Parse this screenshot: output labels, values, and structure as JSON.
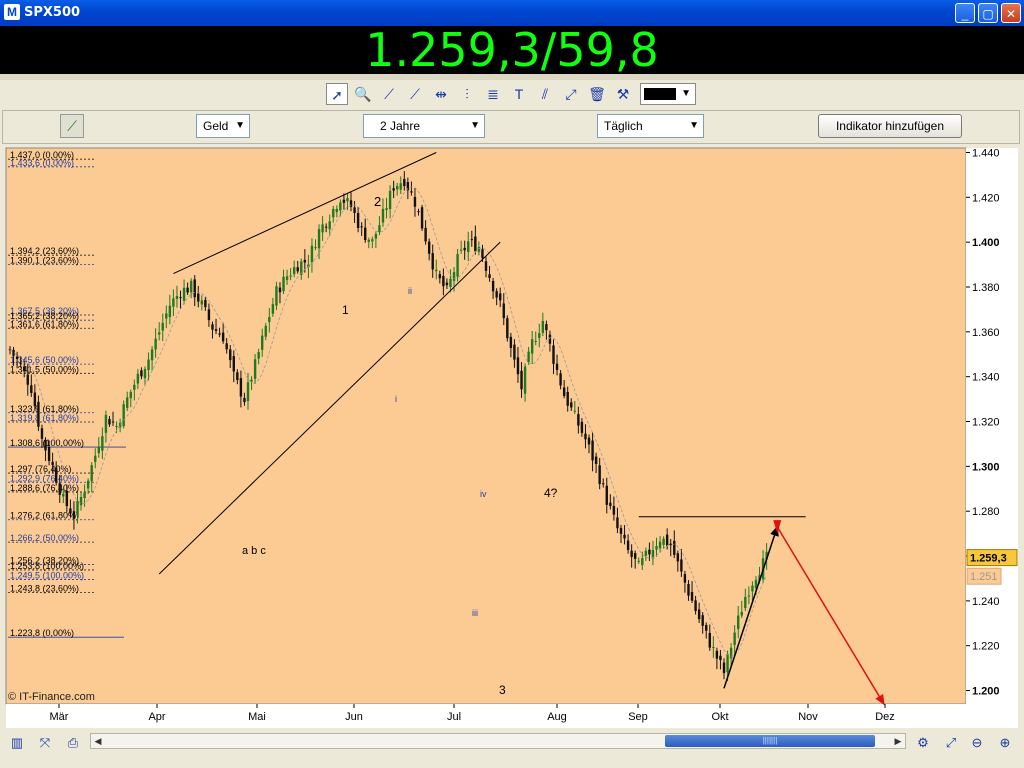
{
  "window": {
    "title": "SPX500",
    "min_label": "_",
    "max_label": "▢",
    "close_label": "✕"
  },
  "quote": {
    "value": "1.259,3/59,8"
  },
  "toolbar": {
    "tools": [
      "pointer-tool",
      "zoom-tool",
      "line-tool",
      "trendline-tool",
      "horizontal-line-tool",
      "vertical-line-tool",
      "fibonacci-tool",
      "text-tool",
      "channel-tool",
      "extend-tool",
      "delete-tool",
      "settings-tool"
    ]
  },
  "controls": {
    "price_type": "Geld",
    "period": "2 Jahre",
    "interval": "Täglich",
    "add_indicator": "Indikator hinzufügen"
  },
  "chart_data": {
    "type": "candlestick",
    "copyright": "© IT-Finance.com",
    "x_ticks": [
      "Mär",
      "Apr",
      "Mai",
      "Jun",
      "Jul",
      "Aug",
      "Sep",
      "Okt",
      "Nov",
      "Dez"
    ],
    "y_ticks": [
      "1.440",
      "1.420",
      "1.400",
      "1.380",
      "1.360",
      "1.340",
      "1.320",
      "1.300",
      "1.280",
      "1.260",
      "1.240",
      "1.220",
      "1.200"
    ],
    "y_tick_values": [
      1440,
      1420,
      1400,
      1380,
      1360,
      1340,
      1320,
      1300,
      1280,
      1260,
      1240,
      1220,
      1200
    ],
    "bold_y_ticks": [
      1400,
      1300,
      1200
    ],
    "ylim": [
      1194,
      1442
    ],
    "last_price_label": "1.259,3",
    "last_price_value": 1259.3,
    "secondary_price_label": "1.251",
    "secondary_price_value": 1251,
    "fib_labels": [
      {
        "text": "1.437,0 (0,00%)",
        "value": 1437.0
      },
      {
        "text": "1.433,6 (0,00%)",
        "value": 1433.6
      },
      {
        "text": "1.394,2 (23,60%)",
        "value": 1394.2
      },
      {
        "text": "1.390,1 (23,60%)",
        "value": 1390.1
      },
      {
        "text": "1.367,5 (38,20%)",
        "value": 1367.5
      },
      {
        "text": "1.365,2 (38,20%)",
        "value": 1365.2
      },
      {
        "text": "1.361,6 (61,80%)",
        "value": 1361.6
      },
      {
        "text": "1.345,6 (50,00%)",
        "value": 1345.6
      },
      {
        "text": "1.341,5 (50,00%)",
        "value": 1341.5
      },
      {
        "text": "1.323,9 (61,80%)",
        "value": 1323.9
      },
      {
        "text": "1.319,8 (61,80%)",
        "value": 1319.8
      },
      {
        "text": "1.308,6 (100,00%)",
        "value": 1308.6
      },
      {
        "text": "1.297 (76,40%)",
        "value": 1297.0
      },
      {
        "text": "1.292,9 (76,40%)",
        "value": 1292.9
      },
      {
        "text": "1.288,6 (76,40%)",
        "value": 1288.6
      },
      {
        "text": "1.276,2 (61,80%)",
        "value": 1276.2
      },
      {
        "text": "1.266,2 (50,00%)",
        "value": 1266.2
      },
      {
        "text": "1.256,2 (38,20%)",
        "value": 1256.2
      },
      {
        "text": "1.253,8 (100,00%)",
        "value": 1253.8
      },
      {
        "text": "1.249,5 (100,00%)",
        "value": 1249.5
      },
      {
        "text": "1.243,8 (23,60%)",
        "value": 1243.8
      },
      {
        "text": "1.223,8 (0,00%)",
        "value": 1223.8
      }
    ],
    "annotations": [
      {
        "text": "a b c",
        "x": "Mai",
        "y": 1258
      },
      {
        "text": "1",
        "x": "Mai-end",
        "y": 1364
      },
      {
        "text": "2",
        "x": "Mai-end",
        "y": 1410
      },
      {
        "text": "ii",
        "x": "Jun",
        "y": 1378
      },
      {
        "text": "i",
        "x": "Jun",
        "y": 1323
      },
      {
        "text": "iv",
        "x": "Jul",
        "y": 1282
      },
      {
        "text": "4?",
        "x": "Jul-end",
        "y": 1282
      },
      {
        "text": "iii",
        "x": "Jul",
        "y": 1228
      },
      {
        "text": "3",
        "x": "Jul",
        "y": 1196
      }
    ],
    "series": [
      {
        "type": "candlestick",
        "color": "#1e7a1e",
        "down_color": "#b01010"
      }
    ],
    "close_path": [
      [
        0,
        1352
      ],
      [
        3,
        1345
      ],
      [
        6,
        1335
      ],
      [
        9,
        1312
      ],
      [
        12,
        1300
      ],
      [
        15,
        1285
      ],
      [
        18,
        1278
      ],
      [
        21,
        1290
      ],
      [
        24,
        1305
      ],
      [
        27,
        1322
      ],
      [
        30,
        1318
      ],
      [
        33,
        1330
      ],
      [
        36,
        1340
      ],
      [
        39,
        1348
      ],
      [
        42,
        1360
      ],
      [
        45,
        1372
      ],
      [
        48,
        1378
      ],
      [
        51,
        1380
      ],
      [
        54,
        1372
      ],
      [
        57,
        1362
      ],
      [
        60,
        1358
      ],
      [
        63,
        1340
      ],
      [
        66,
        1330
      ],
      [
        69,
        1345
      ],
      [
        72,
        1362
      ],
      [
        75,
        1378
      ],
      [
        78,
        1385
      ],
      [
        81,
        1390
      ],
      [
        84,
        1392
      ],
      [
        87,
        1405
      ],
      [
        90,
        1412
      ],
      [
        93,
        1420
      ],
      [
        96,
        1416
      ],
      [
        99,
        1405
      ],
      [
        102,
        1400
      ],
      [
        105,
        1412
      ],
      [
        108,
        1425
      ],
      [
        111,
        1428
      ],
      [
        114,
        1418
      ],
      [
        117,
        1402
      ],
      [
        120,
        1385
      ],
      [
        123,
        1378
      ],
      [
        126,
        1392
      ],
      [
        129,
        1400
      ],
      [
        132,
        1398
      ],
      [
        135,
        1385
      ],
      [
        138,
        1372
      ],
      [
        141,
        1352
      ],
      [
        144,
        1335
      ],
      [
        147,
        1355
      ],
      [
        150,
        1365
      ],
      [
        153,
        1348
      ],
      [
        156,
        1332
      ],
      [
        159,
        1322
      ],
      [
        162,
        1312
      ],
      [
        165,
        1300
      ],
      [
        168,
        1285
      ],
      [
        171,
        1272
      ],
      [
        174,
        1262
      ],
      [
        177,
        1255
      ],
      [
        180,
        1262
      ],
      [
        183,
        1268
      ],
      [
        186,
        1265
      ],
      [
        189,
        1252
      ],
      [
        192,
        1240
      ],
      [
        195,
        1228
      ],
      [
        198,
        1218
      ],
      [
        201,
        1208
      ],
      [
        204,
        1226
      ],
      [
        207,
        1242
      ],
      [
        210,
        1252
      ],
      [
        213,
        1259
      ]
    ],
    "drawings": {
      "channel_upper": [
        [
          46,
          1386
        ],
        [
          120,
          1440
        ]
      ],
      "channel_lower": [
        [
          42,
          1252
        ],
        [
          138,
          1400
        ]
      ],
      "horizontal_4q": 1277.5,
      "black_arrow": [
        [
          201,
          1201
        ],
        [
          216,
          1273
        ]
      ],
      "red_arrow": [
        [
          216,
          1273
        ],
        [
          246,
          1194
        ]
      ]
    }
  },
  "bottombar": {
    "icons": [
      "chart-type-icon",
      "drawing-icon",
      "print-icon",
      "settings-icon",
      "draw-tools-icon",
      "zoom-fit-icon",
      "zoom-out-icon",
      "zoom-in-icon"
    ]
  }
}
